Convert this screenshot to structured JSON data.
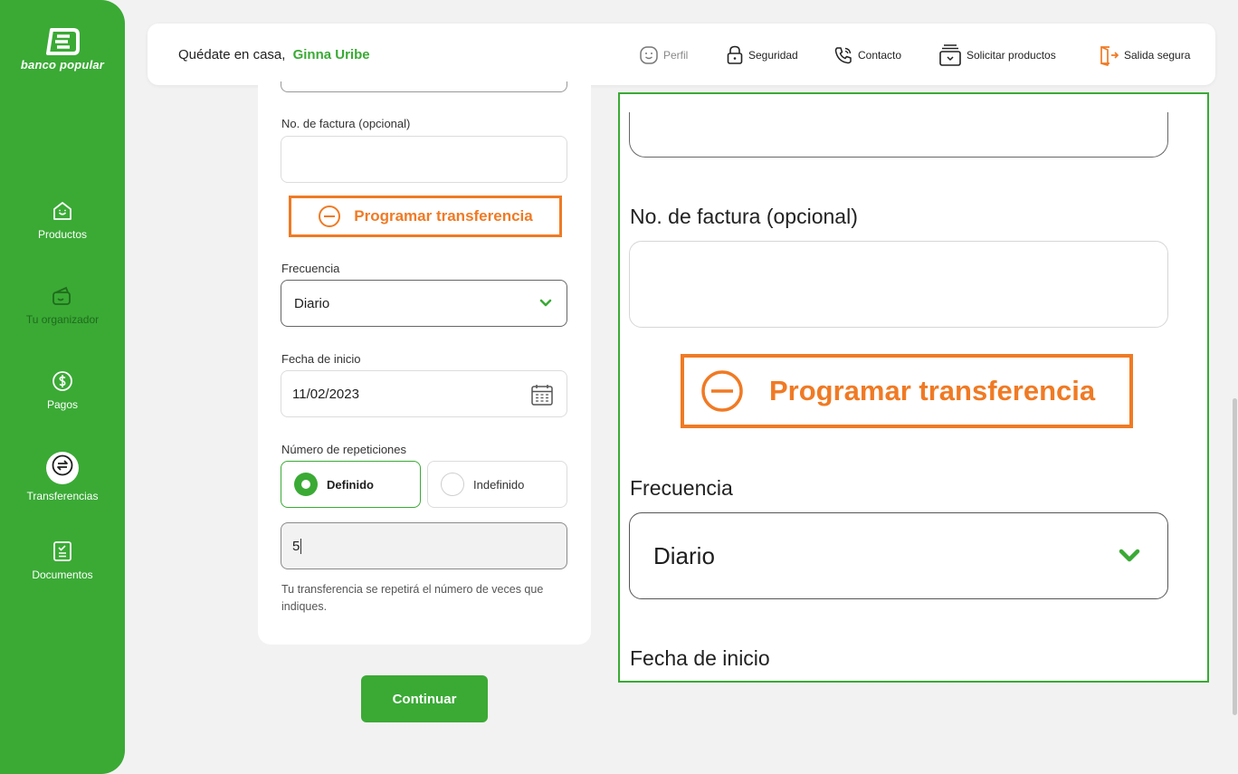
{
  "brand": {
    "name": "banco popular"
  },
  "sidebar": {
    "items": [
      {
        "label": "Productos",
        "icon": "home-smile-icon"
      },
      {
        "label": "Tu organizador",
        "icon": "wallet-icon"
      },
      {
        "label": "Pagos",
        "icon": "dollar-icon"
      },
      {
        "label": "Transferencias",
        "icon": "transfer-icon",
        "active": true
      },
      {
        "label": "Documentos",
        "icon": "document-icon"
      }
    ]
  },
  "header": {
    "greeting": "Quédate en casa,",
    "user_name": "Ginna Uribe",
    "nav": [
      {
        "label": "Perfil",
        "icon": "smile-face-icon"
      },
      {
        "label": "Seguridad",
        "icon": "lock-icon"
      },
      {
        "label": "Contacto",
        "icon": "phone-icon"
      },
      {
        "label": "Solicitar productos",
        "icon": "box-stack-icon"
      },
      {
        "label": "Salida segura",
        "icon": "exit-door-icon"
      }
    ]
  },
  "form": {
    "invoice_label": "No. de factura (opcional)",
    "invoice_value": "",
    "schedule_button": "Programar transferencia",
    "frequency_label": "Frecuencia",
    "frequency_value": "Diario",
    "start_date_label": "Fecha de inicio",
    "start_date_value": "11/02/2023",
    "repetitions_label": "Número de repeticiones",
    "option_defined": "Definido",
    "option_undefined": "Indefinido",
    "repetitions_value": "5",
    "hint": "Tu transferencia se repetirá el número de veces que indiques.",
    "continue_button": "Continuar"
  },
  "colors": {
    "primary": "#3aaa35",
    "accent": "#f07a24",
    "background": "#f2f2f2"
  }
}
